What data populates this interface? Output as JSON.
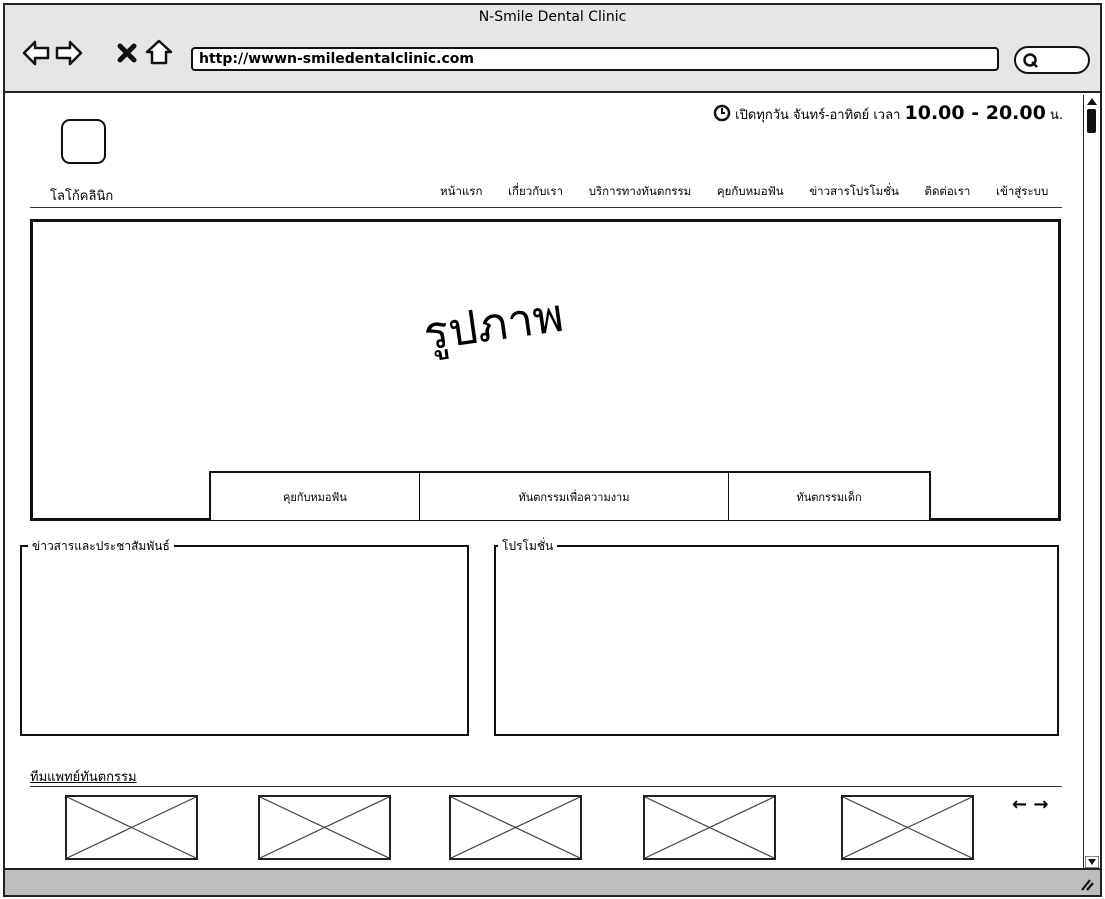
{
  "window": {
    "title": "N-Smile Dental Clinic"
  },
  "toolbar": {
    "url": "http://wwwn-smiledentalclinic.com",
    "icons": [
      "back-arrow-icon",
      "forward-arrow-icon",
      "stop-icon",
      "home-icon",
      "search-icon"
    ]
  },
  "header": {
    "hours_prefix": "เปิดทุกวัน จันทร์-อาทิตย์ เวลา",
    "hours_time": "10.00 - 20.00",
    "hours_suffix": "น.",
    "logo_label": "โลโก้คลินิก"
  },
  "nav": {
    "items": [
      "หน้าแรก",
      "เกี่ยวกับเรา",
      "บริการทางทันตกรรม",
      "คุยกับหมอฟัน",
      "ข่าวสารโปรโมชั่น",
      "ติดต่อเรา",
      "เข้าสู่ระบบ"
    ]
  },
  "hero": {
    "image_label": "รูปภาพ",
    "tabs": [
      "คุยกับหมอฟัน",
      "ทันตกรรมเพื่อความงาม",
      "ทันตกรรมเด็ก"
    ]
  },
  "panels": {
    "news_title": "ข่าวสารและประชาสัมพันธ์",
    "promo_title": "โปรโมชั่น"
  },
  "team": {
    "title": "ทีมแพทย์ทันตกรรม",
    "arrows": "← →",
    "placeholder_count": 5
  }
}
